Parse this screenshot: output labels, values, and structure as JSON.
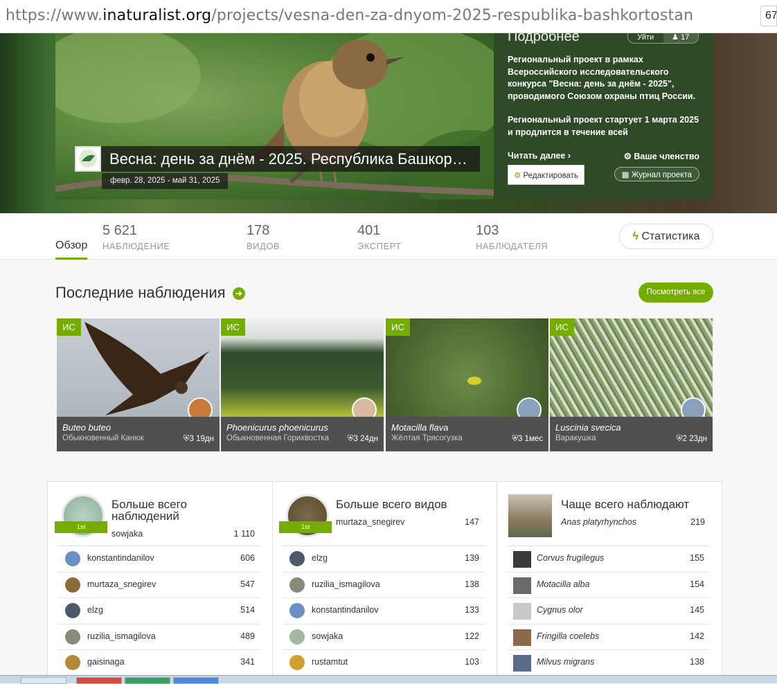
{
  "browser": {
    "url_prefix": "https://www.",
    "url_domain": "inaturalist.org",
    "url_path": "/projects/vesna-den-za-dnyom-2025-respublika-bashkortostan",
    "zoom": "67"
  },
  "project": {
    "more_heading": "Подробнее",
    "leave_label": "Уйти",
    "members_count": "17",
    "description_p1": "Региональный проект в рамках Всероссийского исследовательского конкурса \"Весна: день за днём - 2025\", проводимого Союзом охраны птиц России.",
    "description_p2": "Региональный проект стартует 1 марта 2025 и продлится в течение всей",
    "read_more": "Читать далее",
    "membership": "Ваше членство",
    "edit_button": "Редактировать",
    "journal_button": "Журнал проекта",
    "title": "Весна: день за днём - 2025. Республика Башкор…",
    "dates": "февр. 28, 2025 - май 31, 2025"
  },
  "stats": {
    "overview_tab": "Обзор",
    "observations_num": "5 621",
    "observations_label": "НАБЛЮДЕНИЕ",
    "species_num": "178",
    "species_label": "ВИДОВ",
    "experts_num": "401",
    "experts_label": "ЭКСПЕРТ",
    "observers_num": "103",
    "observers_label": "НАБЛЮДАТЕЛЯ",
    "statistics_button": "Статистика"
  },
  "latest": {
    "title": "Последние наблюдения",
    "view_all": "Посмотреть все",
    "items": [
      {
        "badge": "ИС",
        "scientific": "Buteo buteo",
        "common": "Обыкновенный Канюк",
        "ids": "3",
        "age": "19дн"
      },
      {
        "badge": "ИС",
        "scientific": "Phoenicurus phoenicurus",
        "common": "Обыкновенная Горихвостка",
        "ids": "3",
        "age": "24дн"
      },
      {
        "badge": "ИС",
        "scientific": "Motacilla flava",
        "common": "Жёлтая Трясогузка",
        "ids": "3",
        "age": "1мес"
      },
      {
        "badge": "ИС",
        "scientific": "Luscinia svecica",
        "common": "Варакушка",
        "ids": "2",
        "age": "23дн"
      }
    ]
  },
  "boards": {
    "most_observations": {
      "title": "Больше всего наблюдений",
      "rank": "1st",
      "leader": {
        "name": "sowjaka",
        "count": "1 110"
      },
      "rows": [
        {
          "name": "konstantindanilov",
          "count": "606"
        },
        {
          "name": "murtaza_snegirev",
          "count": "547"
        },
        {
          "name": "elzg",
          "count": "514"
        },
        {
          "name": "ruzilia_ismagilova",
          "count": "489"
        },
        {
          "name": "gaisinaga",
          "count": "341"
        }
      ]
    },
    "most_species": {
      "title": "Больше всего видов",
      "rank": "1st",
      "leader": {
        "name": "murtaza_snegirev",
        "count": "147"
      },
      "rows": [
        {
          "name": "elzg",
          "count": "139"
        },
        {
          "name": "ruzilia_ismagilova",
          "count": "138"
        },
        {
          "name": "konstantindanilov",
          "count": "133"
        },
        {
          "name": "sowjaka",
          "count": "122"
        },
        {
          "name": "rustamtut",
          "count": "103"
        }
      ]
    },
    "most_observed": {
      "title": "Чаще всего наблюдают",
      "leader": {
        "name": "Anas platyrhynchos",
        "count": "219"
      },
      "rows": [
        {
          "name": "Corvus frugilegus",
          "count": "155"
        },
        {
          "name": "Motacilla alba",
          "count": "154"
        },
        {
          "name": "Cygnus olor",
          "count": "145"
        },
        {
          "name": "Fringilla coelebs",
          "count": "142"
        },
        {
          "name": "Milvus migrans",
          "count": "138"
        }
      ]
    }
  },
  "colors": {
    "accent": "#74ac00",
    "hero_panel": "#2e4a26",
    "caption_bg": "#505050"
  }
}
